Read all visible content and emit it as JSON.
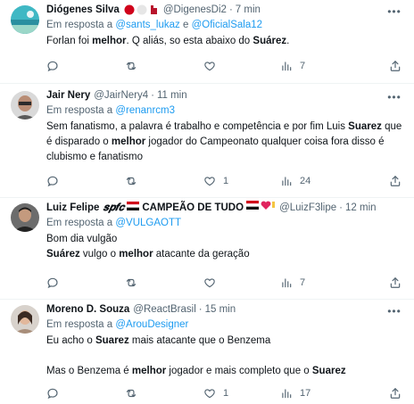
{
  "in_reply_to_label": "Em resposta a",
  "and_label": "e",
  "separator": "·",
  "tweets": [
    {
      "name": "Diógenes Silva",
      "handle": "@DigenesDi2",
      "time": "7 min",
      "reply_to": [
        "@sants_lukaz",
        "@OficialSala12"
      ],
      "text_parts": [
        {
          "t": "Forlan foi ",
          "b": false
        },
        {
          "t": "melhor",
          "b": true
        },
        {
          "t": ". Q aliás, so esta abaixo do ",
          "b": false
        },
        {
          "t": "Suárez",
          "b": true
        },
        {
          "t": ".",
          "b": false
        }
      ],
      "counts": {
        "replies": "",
        "retweets": "",
        "likes": "",
        "views": "7"
      }
    },
    {
      "name": "Jair Nery",
      "handle": "@JairNery4",
      "time": "11 min",
      "reply_to": [
        "@renanrcm3"
      ],
      "text_parts": [
        {
          "t": "Sem fanatismo, a palavra é trabalho e competência e por fim Luis ",
          "b": false
        },
        {
          "t": "Suarez",
          "b": true
        },
        {
          "t": " que é disparado o ",
          "b": false
        },
        {
          "t": "melhor",
          "b": true
        },
        {
          "t": " jogador do Campeonato qualquer coisa fora disso é clubismo e fanatismo",
          "b": false
        }
      ],
      "counts": {
        "replies": "",
        "retweets": "",
        "likes": "1",
        "views": "24"
      }
    },
    {
      "name": "Luiz Felipe",
      "name_badge": "𝒔𝒑𝒇𝒄",
      "name_suffix": "CAMPEÃO DE TUDO",
      "handle": "@LuizF3lipe",
      "time": "12 min",
      "reply_to": [
        "@VULGAOTT"
      ],
      "lines": [
        [
          {
            "t": "Bom dia vulgão",
            "b": false
          }
        ],
        [
          {
            "t": "Suárez",
            "b": true
          },
          {
            "t": " vulgo o ",
            "b": false
          },
          {
            "t": "melhor",
            "b": true
          },
          {
            "t": " atacante da geração",
            "b": false
          }
        ]
      ],
      "counts": {
        "replies": "",
        "retweets": "",
        "likes": "",
        "views": "7"
      }
    },
    {
      "name": "Moreno D. Souza",
      "handle": "@ReactBrasil",
      "time": "15 min",
      "reply_to": [
        "@ArouDesigner"
      ],
      "lines": [
        [
          {
            "t": "Eu acho o ",
            "b": false
          },
          {
            "t": "Suarez",
            "b": true
          },
          {
            "t": " mais atacante que o Benzema",
            "b": false
          }
        ],
        [],
        [
          {
            "t": "Mas o Benzema é ",
            "b": false
          },
          {
            "t": "melhor",
            "b": true
          },
          {
            "t": " jogador e mais completo que o ",
            "b": false
          },
          {
            "t": "Suarez",
            "b": true
          }
        ]
      ],
      "counts": {
        "replies": "",
        "retweets": "",
        "likes": "1",
        "views": "17"
      }
    }
  ]
}
